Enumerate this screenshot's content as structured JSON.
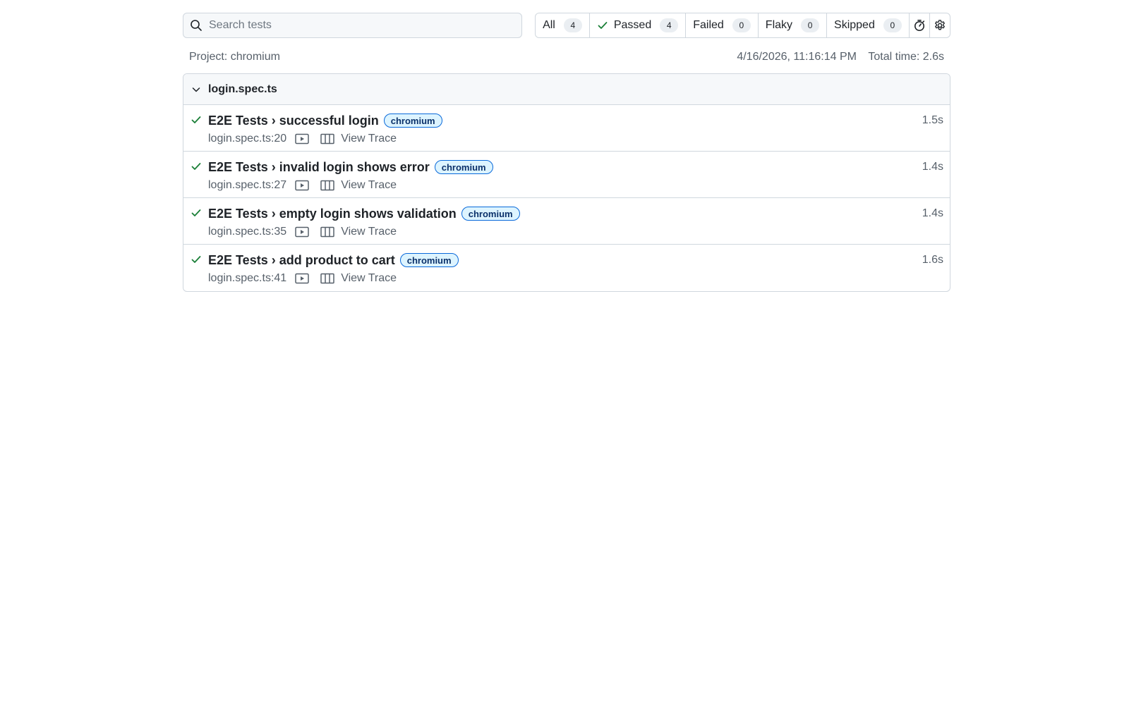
{
  "search": {
    "placeholder": "Search tests",
    "value": ""
  },
  "filters": [
    {
      "label": "All",
      "count": "4"
    },
    {
      "label": "Passed",
      "count": "4",
      "icon": "check-icon"
    },
    {
      "label": "Failed",
      "count": "0"
    },
    {
      "label": "Flaky",
      "count": "0"
    },
    {
      "label": "Skipped",
      "count": "0"
    }
  ],
  "toolbar_icons": [
    "stopwatch-icon",
    "gear-icon"
  ],
  "meta": {
    "project": "Project: chromium",
    "timestamp": "4/16/2026, 11:16:14 PM",
    "total_time": "Total time: 2.6s"
  },
  "group": {
    "file": "login.spec.ts",
    "tests": [
      {
        "title": "E2E Tests › successful login",
        "tag": "chromium",
        "location": "login.spec.ts:20",
        "trace_label": "View Trace",
        "duration": "1.5s",
        "status": "passed"
      },
      {
        "title": "E2E Tests › invalid login shows error",
        "tag": "chromium",
        "location": "login.spec.ts:27",
        "trace_label": "View Trace",
        "duration": "1.4s",
        "status": "passed"
      },
      {
        "title": "E2E Tests › empty login shows validation",
        "tag": "chromium",
        "location": "login.spec.ts:35",
        "trace_label": "View Trace",
        "duration": "1.4s",
        "status": "passed"
      },
      {
        "title": "E2E Tests › add product to cart",
        "tag": "chromium",
        "location": "login.spec.ts:41",
        "trace_label": "View Trace",
        "duration": "1.6s",
        "status": "passed"
      }
    ]
  },
  "colors": {
    "passed": "#1a7f37",
    "tag_border": "#0969da",
    "tag_bg": "#ddf4ff",
    "border": "#d0d7de"
  }
}
